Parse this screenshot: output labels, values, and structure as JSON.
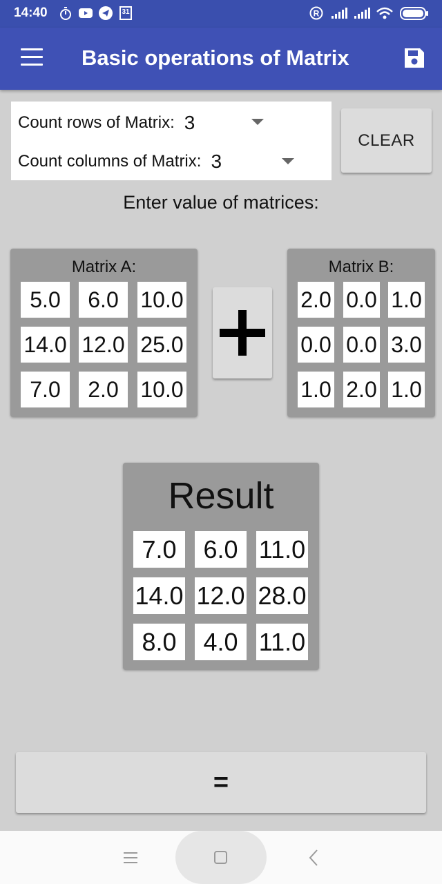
{
  "status_bar": {
    "time": "14:40",
    "icons": [
      "stopwatch-icon",
      "youtube-icon",
      "telegram-icon",
      "calendar-icon",
      "registered-icon",
      "signal-icon",
      "signal-icon",
      "wifi-icon",
      "battery-icon"
    ],
    "calendar_day": "31"
  },
  "app_bar": {
    "title": "Basic operations of Matrix",
    "menu_icon": "hamburger-menu-icon",
    "save_icon": "floppy-save-icon",
    "background": "#3f51b5"
  },
  "dimensions": {
    "rows_label": "Count rows of Matrix:",
    "rows_value": "3",
    "cols_label": "Count columns of Matrix:",
    "cols_value": "3"
  },
  "clear_label": "CLEAR",
  "prompt": "Enter value of matrices:",
  "matrix_a": {
    "title": "Matrix A:",
    "cells": [
      [
        "5.0",
        "6.0",
        "10.0"
      ],
      [
        "14.0",
        "12.0",
        "25.0"
      ],
      [
        "7.0",
        "2.0",
        "10.0"
      ]
    ]
  },
  "operation": "+",
  "matrix_b": {
    "title": "Matrix B:",
    "cells": [
      [
        "2.0",
        "0.0",
        "1.0"
      ],
      [
        "0.0",
        "0.0",
        "3.0"
      ],
      [
        "1.0",
        "2.0",
        "1.0"
      ]
    ]
  },
  "result": {
    "title": "Result",
    "cells": [
      [
        "7.0",
        "6.0",
        "11.0"
      ],
      [
        "14.0",
        "12.0",
        "28.0"
      ],
      [
        "8.0",
        "4.0",
        "11.0"
      ]
    ]
  },
  "equals_label": "=",
  "nav_bar": {
    "icons": [
      "recents-menu-icon",
      "home-square-icon",
      "back-chevron-icon"
    ]
  }
}
